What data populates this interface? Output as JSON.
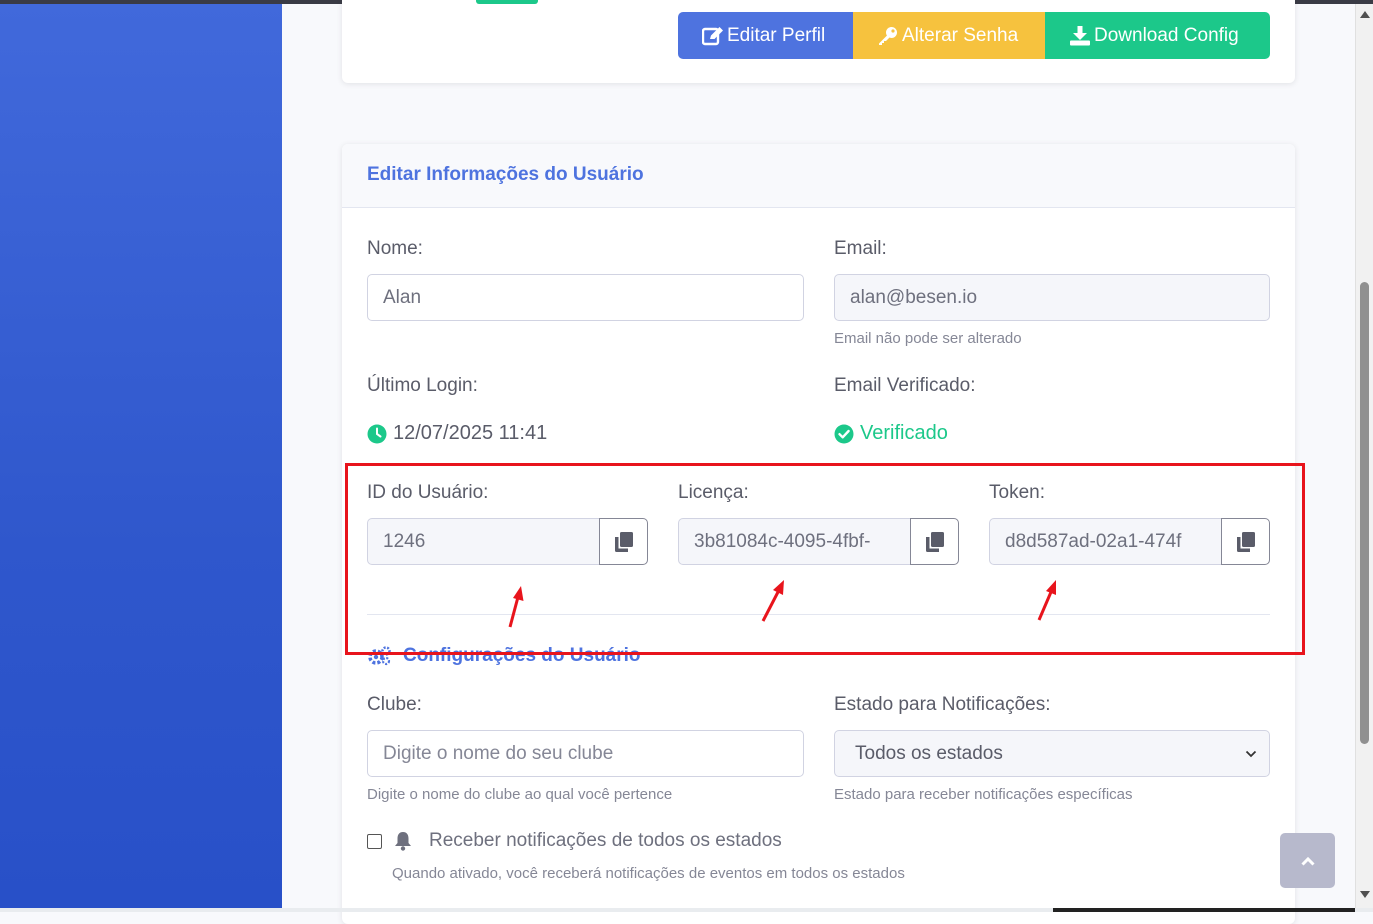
{
  "toolbar": {
    "edit_profile": "Editar Perfil",
    "change_password": "Alterar Senha",
    "download_config": "Download Config"
  },
  "card": {
    "title": "Editar Informações do Usuário"
  },
  "form": {
    "name_label": "Nome:",
    "name_value": "Alan",
    "email_label": "Email:",
    "email_value": "alan@besen.io",
    "email_help": "Email não pode ser alterado",
    "last_login_label": "Último Login:",
    "last_login_value": "12/07/2025 11:41",
    "email_verified_label": "Email Verificado:",
    "email_verified_value": "Verificado",
    "user_id_label": "ID do Usuário:",
    "user_id_value": "1246",
    "license_label": "Licença:",
    "license_value": "3b81084c-4095-4fbf-",
    "token_label": "Token:",
    "token_value": "d8d587ad-02a1-474f"
  },
  "settings": {
    "title": "Configurações do Usuário",
    "club_label": "Clube:",
    "club_placeholder": "Digite o nome do seu clube",
    "club_help": "Digite o nome do clube ao qual você pertence",
    "state_label": "Estado para Notificações:",
    "state_value": "Todos os estados",
    "state_help": "Estado para receber notificações específicas",
    "all_states_label": "Receber notificações de todos os estados",
    "all_states_help": "Quando ativado, você receberá notificações de eventos em todos os estados"
  },
  "colors": {
    "primary": "#4e73df",
    "warning": "#f6c23e",
    "success": "#1cc88a",
    "annotation": "#e8141c"
  }
}
